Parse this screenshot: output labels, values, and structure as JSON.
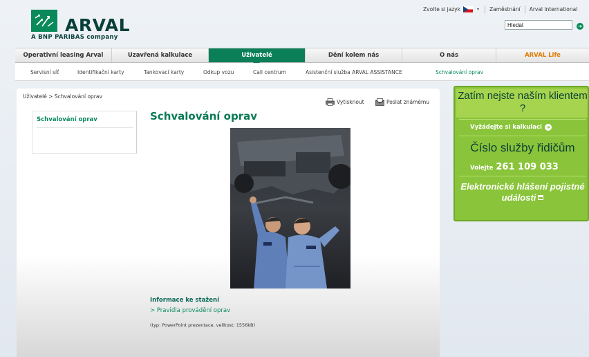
{
  "header": {
    "logo_text": "ARVAL",
    "logo_subtitle": "A BNP PARIBAS company",
    "language_label": "Zvolte si jazyk",
    "top_links": [
      "Zaměstnání",
      "Arval International"
    ],
    "search_value": "Hledat",
    "icons": [
      "arval-logo-icon",
      "czech-flag-icon",
      "search-go-icon"
    ]
  },
  "main_nav": [
    {
      "label": "Operativní leasing Arval"
    },
    {
      "label": "Uzavřená kalkulace"
    },
    {
      "label": "Uživatelé",
      "active": true
    },
    {
      "label": "Dění kolem nás"
    },
    {
      "label": "O nás"
    },
    {
      "label": "ARVAL Life"
    }
  ],
  "sub_nav": [
    {
      "label": "Servisní síť"
    },
    {
      "label": "Identifikační karty"
    },
    {
      "label": "Tankovací karty"
    },
    {
      "label": "Odkup vozu"
    },
    {
      "label": "Call centrum"
    },
    {
      "label": "Asistenční služba ARVAL ASSISTANCE"
    },
    {
      "label": "Schvalování oprav",
      "active": true
    }
  ],
  "breadcrumb": "Uživatelé > Schvalování oprav",
  "left_menu": [
    "Schvalování oprav"
  ],
  "tools": {
    "print": "Vytisknout",
    "send": "Poslat známému"
  },
  "page_title": "Schvalování oprav",
  "download": {
    "heading": "Informace ke stažení",
    "link": "> Pravidla provádění oprav",
    "info": "(typ: PowerPoint prezentace, velikost: 1556kB)"
  },
  "promo": {
    "headline": "Zatím nejste naším klientem ?",
    "calc_link": "Vyžádejte si kalkulaci",
    "service_title": "Číslo služby řidičům",
    "call_label": "Volejte",
    "phone": "261 109 033",
    "report_link": "Elektronické hlášení pojistné události"
  },
  "colors": {
    "brand_green": "#0b7f57",
    "promo_green": "#8ac43a",
    "orange": "#e07a00"
  }
}
